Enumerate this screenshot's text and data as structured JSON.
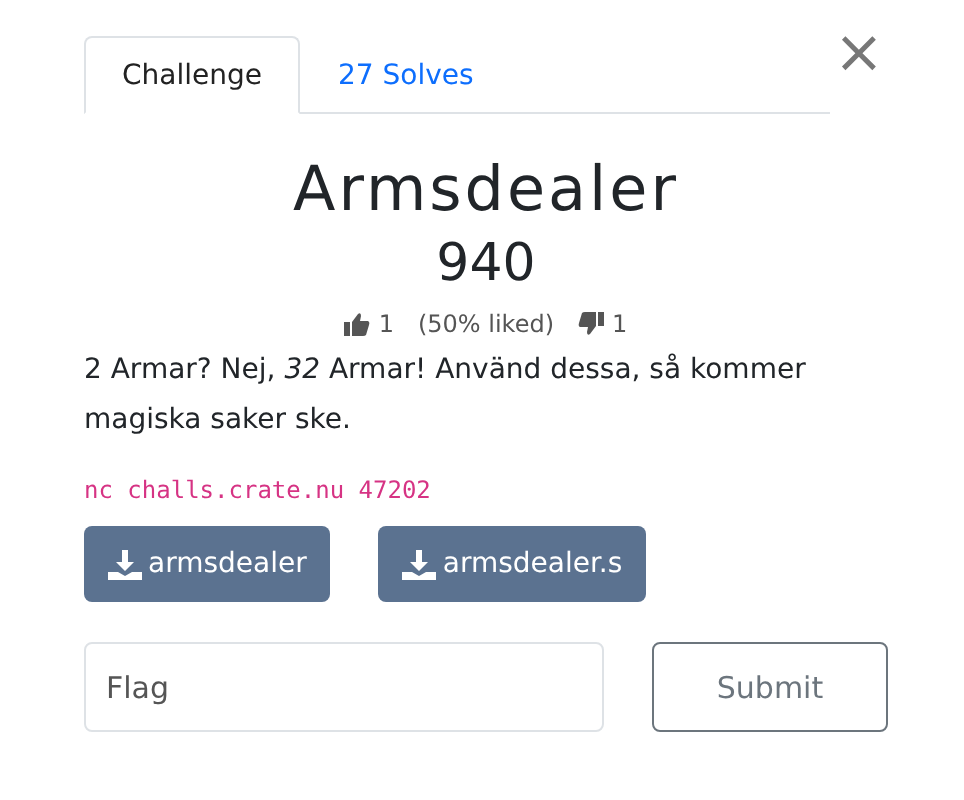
{
  "tabs": [
    {
      "label": "Challenge",
      "selected": true
    },
    {
      "label": "27 Solves",
      "selected": false
    }
  ],
  "close": {
    "label": "×"
  },
  "challenge": {
    "name": "Armsdealer",
    "value": "940"
  },
  "votes": {
    "likes": "1",
    "liked": "(50% liked)",
    "dislikes": "1"
  },
  "description": "2 Armar? Nej, *32* Armar! Använd dessa, så kommer magiska saker ske.",
  "connection": "nc challs.crate.nu 47202",
  "files": [
    {
      "label": "armsdealer"
    },
    {
      "label": "armsdealer.s"
    }
  ],
  "flag": {
    "placeholder": "Flag"
  },
  "submit": {
    "label": "Submit"
  }
}
